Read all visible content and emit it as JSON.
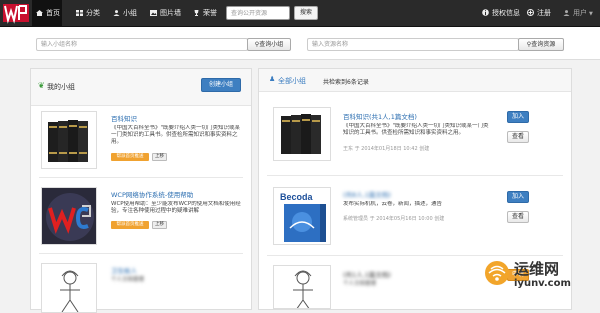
{
  "navbar": {
    "items": [
      {
        "icon": "home-icon",
        "label": "首页"
      },
      {
        "icon": "category-icon",
        "label": "分类"
      },
      {
        "icon": "user-icon",
        "label": "小组"
      },
      {
        "icon": "image-icon",
        "label": "图片墙"
      },
      {
        "icon": "trophy-icon",
        "label": "荣誉"
      }
    ],
    "search_placeholder": "查询公开资源",
    "search_button": "搜索",
    "right": [
      {
        "icon": "info-icon",
        "label": "授权信息"
      },
      {
        "icon": "register-icon",
        "label": "注册"
      },
      {
        "icon": "user-icon",
        "label": "用户"
      }
    ]
  },
  "topbar": {
    "group_search_placeholder": "输入小组名称",
    "group_search_button": "查询小组",
    "resource_search_placeholder": "输入资源名称",
    "resource_search_button": "查询资源"
  },
  "left": {
    "title": "我的小组",
    "create_button": "创建小组",
    "cards": [
      {
        "title": "百科知识",
        "desc": "《中国大百科全书》\"既要介绍人类一切门类知识或某一门类知识的工具书。供查检所需知识和事实资料之用。",
        "tag_primary": "帮派首页推送",
        "tag_secondary": "上移"
      },
      {
        "title": "WCP网络协作系统-使用帮助",
        "desc": "WCP使用帮助：至少能发布WCP的使用文档和使用经验，专注各种使用过程中的疑难讲解",
        "tag_primary": "帮派首页推送",
        "tag_secondary": "上移"
      },
      {
        "title": "卫生帐人",
        "desc": "个人文档管理"
      }
    ]
  },
  "right": {
    "title": "全部小组",
    "count_text": "共检索到6条记录",
    "cards": [
      {
        "title": "百科知识(共1人,1篇文档)",
        "desc": "《中国大百科全书》\"既要介绍人类一切门类知识或某一门类知识的工具书。供查检所需知识和事实资料之用。",
        "meta": "王东  于 2014年01月18日 10:42 创建",
        "join_button": "加入",
        "view_button": "查看"
      },
      {
        "title": "(共8人,1篇文档)",
        "desc": "发布实际机机，云卷，新闻，描述，通告",
        "meta": "系统管理员  于 2014年05月16日 10:00 创建",
        "join_button": "加入",
        "view_button": "查看"
      },
      {
        "title": "(共1人,1篇文档)",
        "desc": "个人文档管理",
        "join_button": "申请"
      }
    ]
  },
  "watermark": {
    "text": "运维网",
    "url": "iyunv.com"
  }
}
